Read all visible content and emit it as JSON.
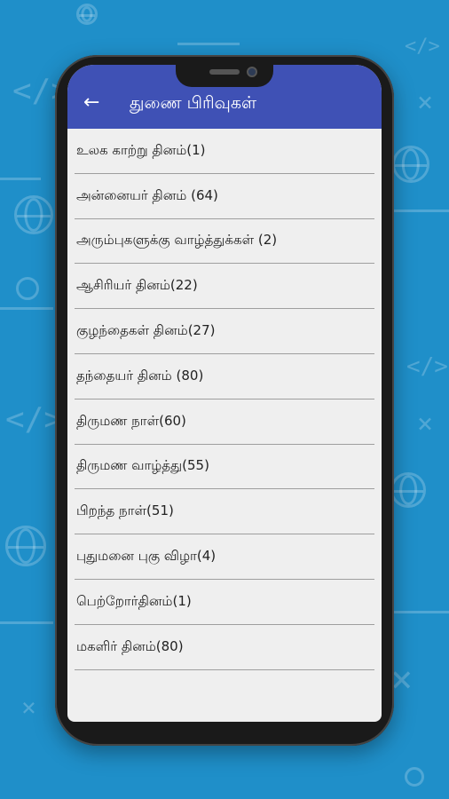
{
  "header": {
    "title": "துணை பிரிவுகள்",
    "back_icon": "arrow-back-icon"
  },
  "colors": {
    "appbar": "#3f51b5",
    "background": "#1f8fc9"
  },
  "list": {
    "items": [
      "உலக காற்று தினம்(1)",
      "அன்னையர் தினம்  (64)",
      "அரும்புகளுக்கு வாழ்த்துக்கள் (2)",
      "ஆசிரியர் தினம்(22)",
      "குழந்தைகள் தினம்(27)",
      "தந்தையர் தினம் (80)",
      "திருமண நாள்(60)",
      "திருமண வாழ்த்து(55)",
      "பிறந்த நாள்(51)",
      "புதுமனை புகு விழா(4)",
      "பெற்றோர்தினம்(1)",
      "மகளிர் தினம்(80)"
    ]
  }
}
